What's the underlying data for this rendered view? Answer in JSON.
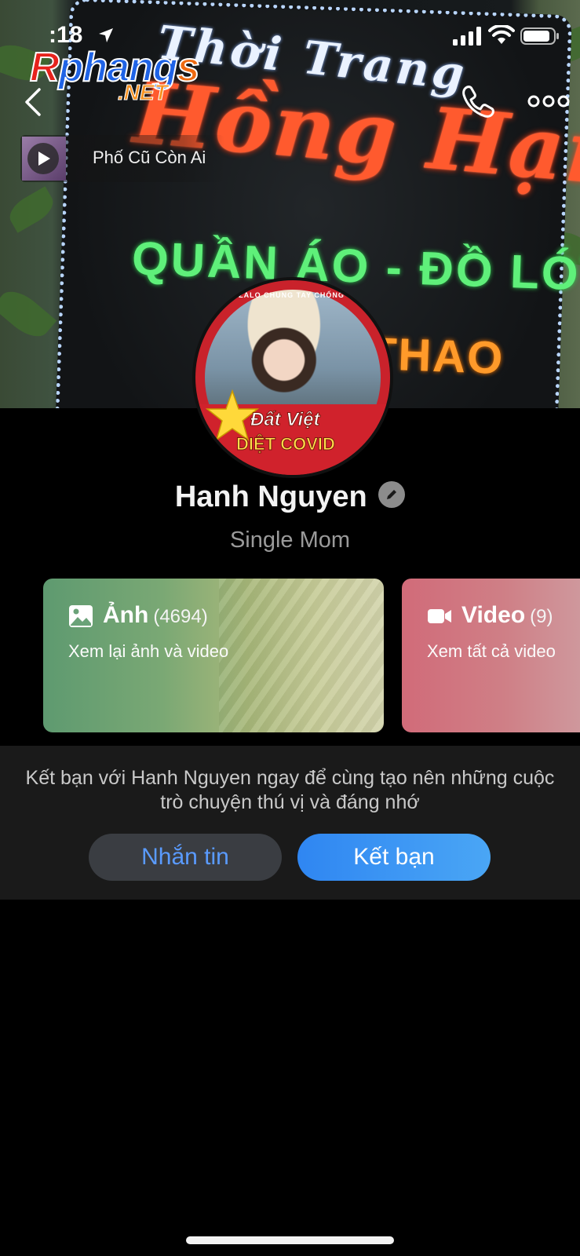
{
  "status_bar": {
    "time": ":18"
  },
  "watermark": {
    "main_r": "R",
    "main_mid": "phang",
    "main_s": "s",
    "sub": ".NET"
  },
  "cover_sign": {
    "line1": "Thời Trang",
    "line2": "Hồng Hạnh",
    "line3": "QUẦN ÁO - ĐỒ LÓT",
    "line4": "THAO"
  },
  "music": {
    "title": "Phố Cũ Còn Ai"
  },
  "avatar": {
    "band_text": "• CÙNG ZALO CHUNG TAY CHỐNG COVID •",
    "line1": "Đất Việt",
    "line2": "DIỆT COVID"
  },
  "profile": {
    "name": "Hanh Nguyen",
    "bio": "Single Mom"
  },
  "media_cards": [
    {
      "title": "Ảnh",
      "count": "(4694)",
      "subtitle": "Xem lại ảnh và video",
      "icon": "image-icon"
    },
    {
      "title": "Video",
      "count": "(9)",
      "subtitle": "Xem tất cả video",
      "icon": "video-camera-icon"
    }
  ],
  "friend_panel": {
    "message": "Kết bạn với Hanh Nguyen ngay để cùng tạo nên những cuộc trò chuyện thú vị và đáng nhớ",
    "message_button": "Nhắn tin",
    "add_friend_button": "Kết bạn"
  },
  "colors": {
    "accent_blue": "#2f86f2",
    "message_button_text": "#5a9bff",
    "panel_bg": "#1a1a1a",
    "photos_card": "#5e9a70",
    "videos_card": "#d16b79"
  }
}
